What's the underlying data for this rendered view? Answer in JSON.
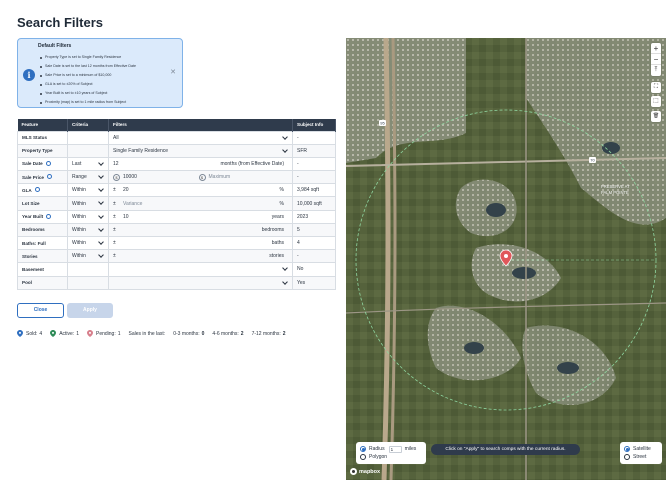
{
  "page": {
    "title": "Search Filters"
  },
  "default_filters": {
    "title": "Default Filters",
    "items": [
      "Property Type is set to Single Family Residence",
      "Sale Date is set to the last 12 months from Effective Date",
      "Sale Price is set to a minimum of $10,000",
      "GLA is set to ±20% of Subject",
      "Year Built is set to ±10 years of Subject",
      "Proximity (map) is set to 1 mile radius from Subject"
    ]
  },
  "table": {
    "headers": [
      "Feature",
      "Criteria",
      "Filters",
      "Subject Info"
    ],
    "rows": {
      "mls_status": {
        "feature": "MLS Status",
        "filter": "All",
        "subject": "-"
      },
      "property_type": {
        "feature": "Property Type",
        "filter": "Single Family Residence",
        "subject": "SFR"
      },
      "sale_date": {
        "feature": "Sale Date",
        "criteria": "Last",
        "value": "12",
        "unit": "months (from Effective Date)",
        "subject": "-"
      },
      "sale_price": {
        "feature": "Sale Price",
        "criteria": "Range",
        "min": "10000",
        "max_placeholder": "Maximum",
        "subject": "-"
      },
      "gla": {
        "feature": "GLA",
        "criteria": "Within",
        "pm": "±",
        "value": "20",
        "unit": "%",
        "subject": "3,984 sqft"
      },
      "lot_size": {
        "feature": "Lot Size",
        "criteria": "Within",
        "pm": "±",
        "placeholder": "Variance",
        "unit": "%",
        "subject": "10,000 sqft"
      },
      "year_built": {
        "feature": "Year Built",
        "criteria": "Within",
        "pm": "±",
        "value": "10",
        "unit": "years",
        "subject": "2023"
      },
      "bedrooms": {
        "feature": "Bedrooms",
        "criteria": "Within",
        "pm": "±",
        "unit": "bedrooms",
        "subject": "5"
      },
      "baths_full": {
        "feature": "Baths: Full",
        "criteria": "Within",
        "pm": "±",
        "unit": "baths",
        "subject": "4"
      },
      "stories": {
        "feature": "Stories",
        "criteria": "Within",
        "pm": "±",
        "unit": "stories",
        "subject": "-"
      },
      "basement": {
        "feature": "Basement",
        "subject": "No"
      },
      "pool": {
        "feature": "Pool",
        "subject": "Yes"
      }
    }
  },
  "buttons": {
    "close": "Close",
    "apply": "Apply"
  },
  "legend": {
    "sold_label": "Sold:",
    "sold_count": "4",
    "active_label": "Active:",
    "active_count": "1",
    "pending_label": "Pending:",
    "pending_count": "1",
    "sales_label": "Sales in the last:",
    "m03_label": "0-3 months:",
    "m03_count": "0",
    "m46_label": "4-6 months:",
    "m46_count": "2",
    "m712_label": "7-12 months:",
    "m712_count": "2"
  },
  "map": {
    "radius_label": "Radius",
    "radius_value": "1",
    "miles_label": "miles",
    "polygon_label": "Polygon",
    "hint": "Click on \"Apply\" to search comps with the current radius.",
    "satellite_label": "Satellite",
    "street_label": "Street",
    "attribution": "mapbox",
    "label_preserve": "PRESERVE AT",
    "label_pointe": "PALM POINTE",
    "road_label_1": "95",
    "road_label_2": "70",
    "controls": [
      "+",
      "−",
      "⤒",
      "⛶",
      "⬚",
      "🗑"
    ],
    "colors": {
      "accent": "#2f6fc0",
      "pin": "#e0575b",
      "radius_line": "#8fd6a0"
    }
  }
}
